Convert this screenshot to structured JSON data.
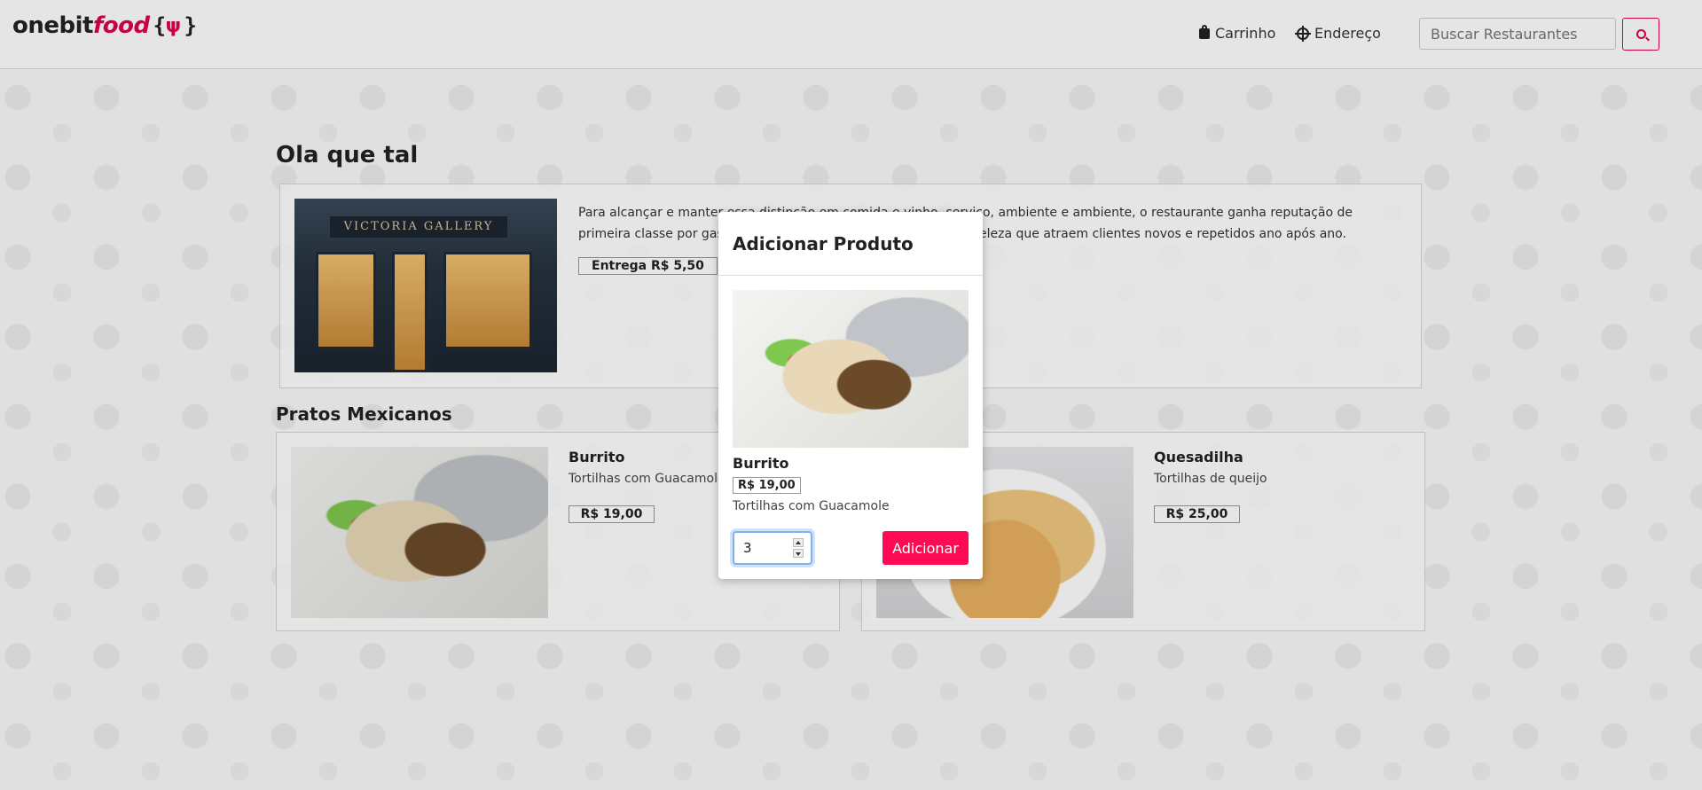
{
  "header": {
    "logo": {
      "part1": "onebit",
      "part2": "food",
      "brace_open": "{",
      "fork": "ψ",
      "brace_close": "}"
    },
    "nav": {
      "cart_label": "Carrinho",
      "address_label": "Endereço"
    },
    "search": {
      "placeholder": "Buscar Restaurantes",
      "value": ""
    }
  },
  "main": {
    "title": "Ola que tal",
    "restaurant": {
      "sign_text": "VICTORIA GALLERY",
      "description": "Para alcançar e manter essa distinção em comida e vinho, serviço, ambiente e ambiente, o restaurante ganha reputação de primeira classe por gastronomia, hospitalidade, consistência e beleza que atraem clientes novos e repetidos ano após ano.",
      "delivery_fee": "Entrega R$ 5,50"
    },
    "section_title": "Pratos Mexicanos",
    "products": [
      {
        "name": "Burrito",
        "description": "Tortilhas com Guacamole",
        "price": "R$ 19,00"
      },
      {
        "name": "Quesadilha",
        "description": "Tortilhas de queijo",
        "price": "R$ 25,00"
      }
    ]
  },
  "modal": {
    "title": "Adicionar Produto",
    "product_name": "Burrito",
    "price": "R$ 19,00",
    "description": "Tortilhas com Guacamole",
    "quantity": "3",
    "add_label": "Adicionar"
  },
  "colors": {
    "brand": "#e0004d",
    "button": "#ff0a55"
  }
}
